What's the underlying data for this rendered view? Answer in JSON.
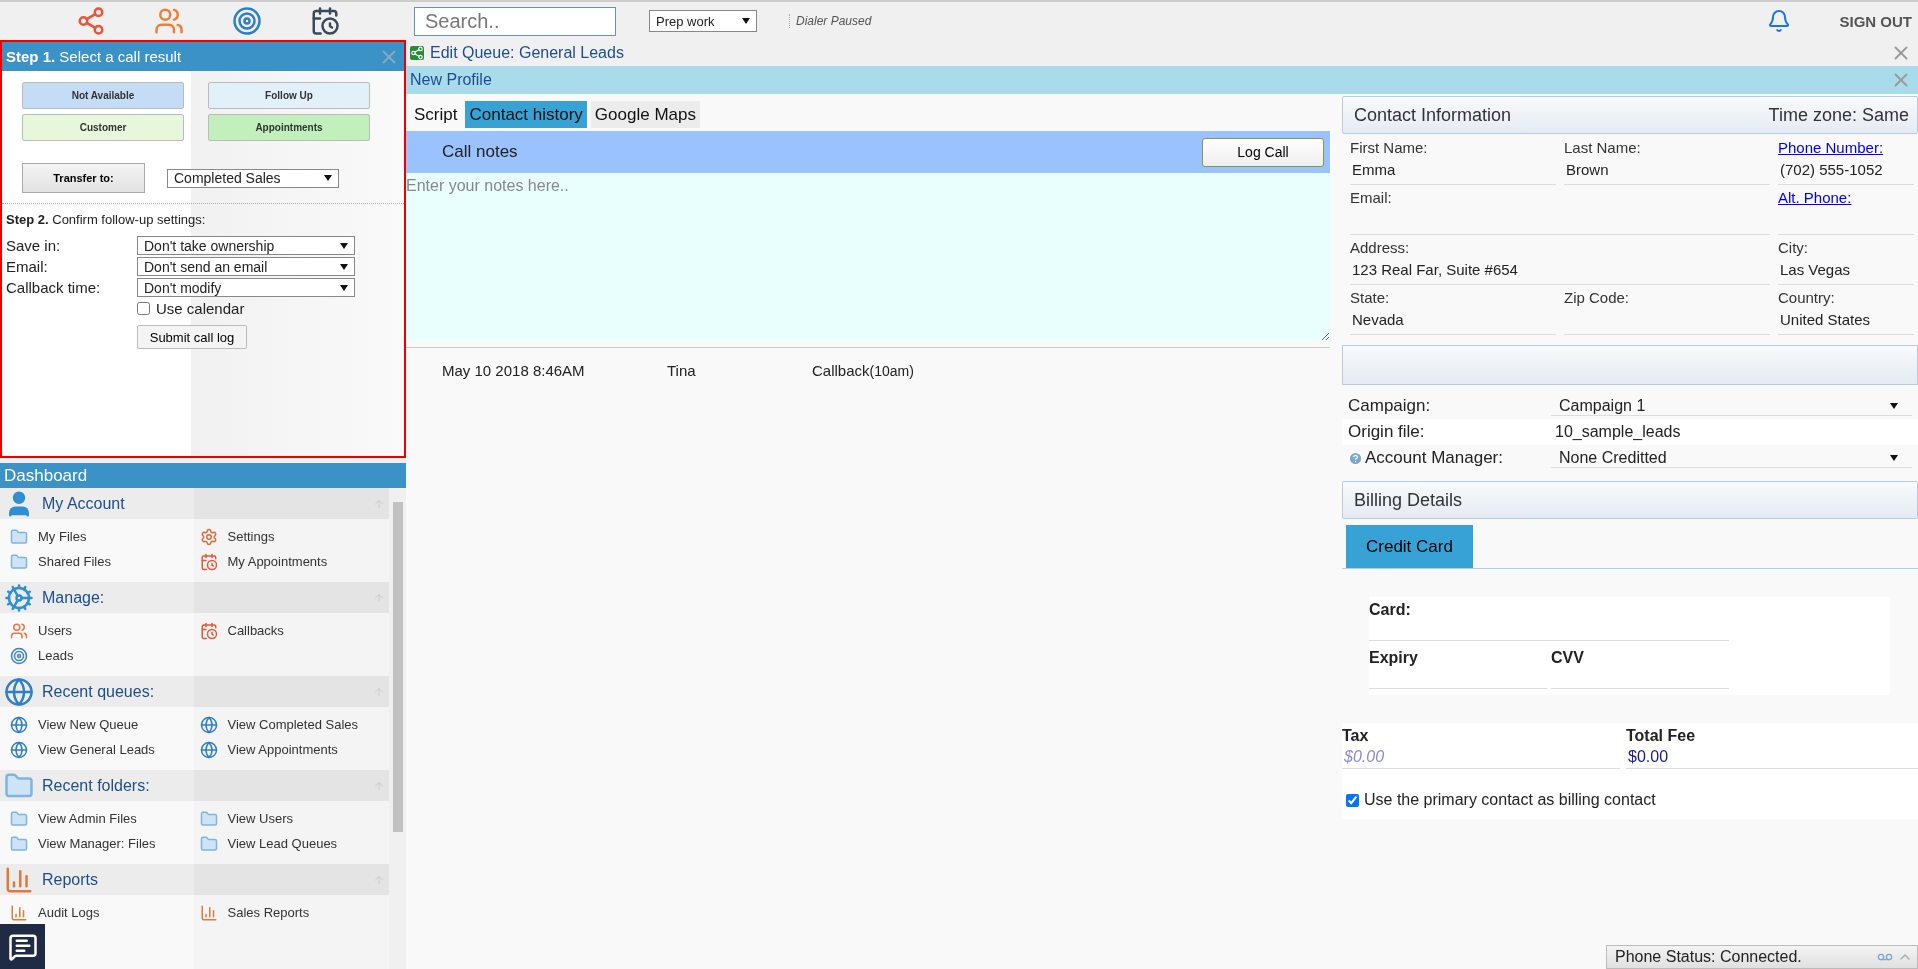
{
  "toolbar": {
    "search": {
      "placeholder": "Search.."
    },
    "status_select": "Prep work",
    "dialer_status": "Dialer Paused",
    "sign_out": "SIGN OUT"
  },
  "step1": {
    "title": "**Step 1.** Select a call result",
    "results": [
      {
        "label": "Not Available",
        "color": "#c4dcf6"
      },
      {
        "label": "Follow Up",
        "color": "#e2f0fa"
      },
      {
        "label": "Customer",
        "color": "#e6f7dc"
      },
      {
        "label": "Appointments",
        "color": "#c2f0bc"
      }
    ],
    "transfer_button": "Transfer to:",
    "transfer_select": "Completed Sales"
  },
  "step2": {
    "title": "**Step 2.** Confirm follow-up settings:",
    "settings": [
      {
        "label": "Save in:",
        "value": "Don't take ownership"
      },
      {
        "label": "Email:",
        "value": "Don't send an email"
      },
      {
        "label": "Callback time:",
        "value": "Don't modify"
      }
    ],
    "use_calendar": {
      "label": "Use calendar",
      "checked": false
    },
    "submit": "Submit call log"
  },
  "dashboard": {
    "title": "Dashboard",
    "sections": [
      {
        "title": "My Account",
        "kind": "person",
        "items": [
          {
            "label": "My Files",
            "kind": "folder"
          },
          {
            "label": "Settings",
            "kind": "settings"
          },
          {
            "label": "Shared Files",
            "kind": "folder"
          },
          {
            "label": "My Appointments",
            "kind": "calendar"
          }
        ]
      },
      {
        "title": "Manage:",
        "kind": "gears",
        "items": [
          {
            "label": "Users",
            "kind": "users"
          },
          {
            "label": "Callbacks",
            "kind": "calendar"
          },
          {
            "label": "Leads",
            "kind": "target"
          }
        ]
      },
      {
        "title": "Recent queues:",
        "kind": "globe",
        "items": [
          {
            "label": "View New Queue",
            "kind": "globe"
          },
          {
            "label": "View Completed Sales",
            "kind": "globe"
          },
          {
            "label": "View General Leads",
            "kind": "globe"
          },
          {
            "label": "View Appointments",
            "kind": "globe"
          }
        ]
      },
      {
        "title": "Recent folders:",
        "kind": "folder",
        "items": [
          {
            "label": "View Admin Files",
            "kind": "folder"
          },
          {
            "label": "View Users",
            "kind": "folder"
          },
          {
            "label": "View Manager: Files",
            "kind": "folder"
          },
          {
            "label": "View Lead Queues",
            "kind": "folder"
          }
        ]
      },
      {
        "title": "Reports",
        "kind": "chart",
        "items": [
          {
            "label": "Audit Logs",
            "kind": "chart"
          },
          {
            "label": "Sales Reports",
            "kind": "chart"
          }
        ]
      }
    ]
  },
  "queue": {
    "title": "Edit Queue: General Leads"
  },
  "profile": {
    "title": "New Profile"
  },
  "tabs": [
    {
      "label": "Script",
      "selected": false
    },
    {
      "label": "Contact history",
      "selected": true
    },
    {
      "label": "Google Maps",
      "selected": false
    }
  ],
  "call_notes": {
    "label": "Call notes",
    "log_button": "Log Call",
    "placeholder": "Enter your notes here.."
  },
  "history": [
    {
      "date": "May 10 2018 8:46AM",
      "agent": "Tina",
      "result": "Callback",
      "detail": "(10am)"
    }
  ],
  "contact": {
    "title": "Contact Information",
    "timezone": "Time zone: Same",
    "rows": [
      [
        {
          "label": "First Name:",
          "value": "Emma",
          "link": false
        },
        {
          "label": "Last Name:",
          "value": "Brown",
          "link": false
        },
        {
          "label": "Phone Number:",
          "value": "(702) 555-1052",
          "link": true
        }
      ],
      [
        {
          "label": "Email:",
          "link": false
        },
        {
          "label": "Alt. Phone:",
          "link": true
        }
      ],
      [
        {
          "label": "Address:",
          "value": "123 Real Far, Suite #654",
          "link": false
        },
        {
          "label": "City:",
          "value": "Las Vegas",
          "link": false
        }
      ],
      [
        {
          "label": "State:",
          "value": "Nevada",
          "link": false
        },
        {
          "label": "Zip Code:",
          "link": false
        },
        {
          "label": "Country:",
          "value": "United States",
          "link": false
        }
      ]
    ]
  },
  "campaign": [
    {
      "label": "Campaign:",
      "value": "Campaign 1",
      "kind": "select",
      "help": false
    },
    {
      "label": "Origin file:",
      "value": "10_sample_leads",
      "kind": "text",
      "help": false
    },
    {
      "label": "Account Manager:",
      "value": "None Creditted",
      "kind": "select",
      "help": true
    }
  ],
  "billing": {
    "title": "Billing Details",
    "tabs": [
      {
        "label": "Credit Card",
        "selected": true
      }
    ],
    "card": {
      "card_label": "Card:",
      "expiry_label": "Expiry",
      "cvv_label": "CVV"
    },
    "tax": {
      "label": "Tax",
      "placeholder": "$0.00"
    },
    "total": {
      "label": "Total Fee",
      "value": "$0.00"
    },
    "primary_contact": {
      "label": "Use the primary contact as billing contact",
      "checked": true
    }
  },
  "phone_status": "Phone Status: Connected."
}
